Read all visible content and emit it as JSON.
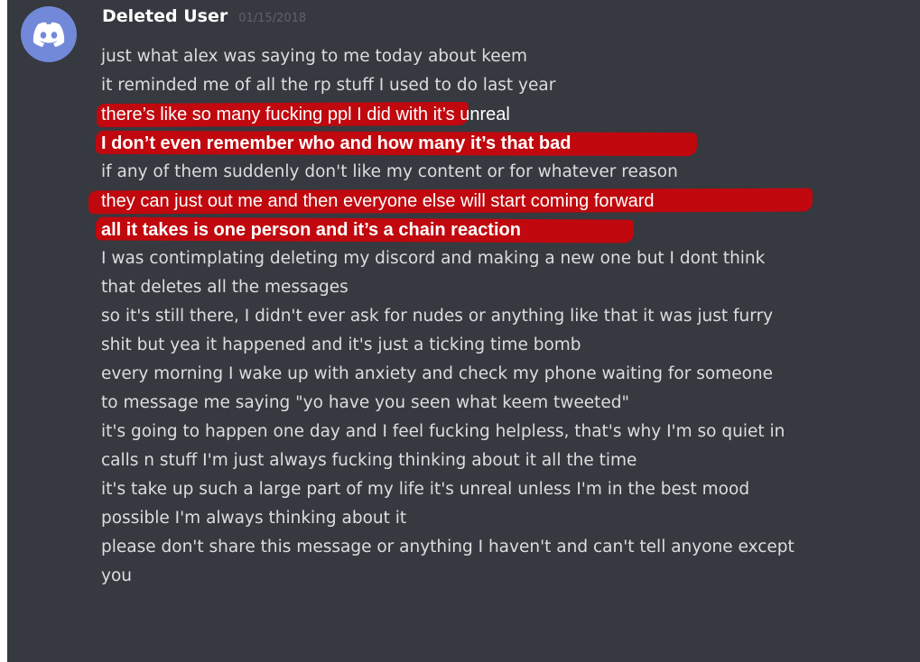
{
  "message": {
    "author": "Deleted User",
    "timestamp": "01/15/2018",
    "avatar_icon": "discord-logo-icon",
    "avatar_color": "#7289da",
    "highlight_color": "#c0080e",
    "lines": [
      {
        "text": "just what alex was saying to me today about keem"
      },
      {
        "text": "it reminded me of all the rp stuff I used to do last year"
      },
      {
        "text": "there’s like so many fucking ppl I did with it’s unreal",
        "highlighted": true,
        "bold": false
      },
      {
        "text": "I don’t even remember who and how many it’s that bad",
        "highlighted": true,
        "bold": true
      },
      {
        "text": "if any of them suddenly don't like my content or for whatever reason"
      },
      {
        "text": "they can just out me and then everyone else will start coming forward",
        "highlighted": true,
        "bold": false
      },
      {
        "text": "all it takes is one person and it’s a chain reaction",
        "highlighted": true,
        "bold": true
      },
      {
        "text": "I was contimplating deleting my discord and making a new one but I dont think"
      },
      {
        "text": "that deletes all the messages"
      },
      {
        "text": "so it's still there, I didn't ever ask for nudes or anything like that it was just furry"
      },
      {
        "text": "shit but yea it happened and it's just a ticking time bomb"
      },
      {
        "text": "every morning I wake up with anxiety and check my phone waiting for someone"
      },
      {
        "text": "to message me saying \"yo have you seen what keem tweeted\""
      },
      {
        "text": "it's going to happen one day and I feel fucking helpless, that's why I'm so quiet in"
      },
      {
        "text": "calls n stuff I'm just always fucking thinking about it all the time"
      },
      {
        "text": "it's take up such a large part of my life it's unreal unless I'm in the best mood"
      },
      {
        "text": "possible I'm always thinking about it"
      },
      {
        "text": "please don't share this message or anything I haven't and can't tell anyone except"
      },
      {
        "text": "you"
      }
    ]
  }
}
